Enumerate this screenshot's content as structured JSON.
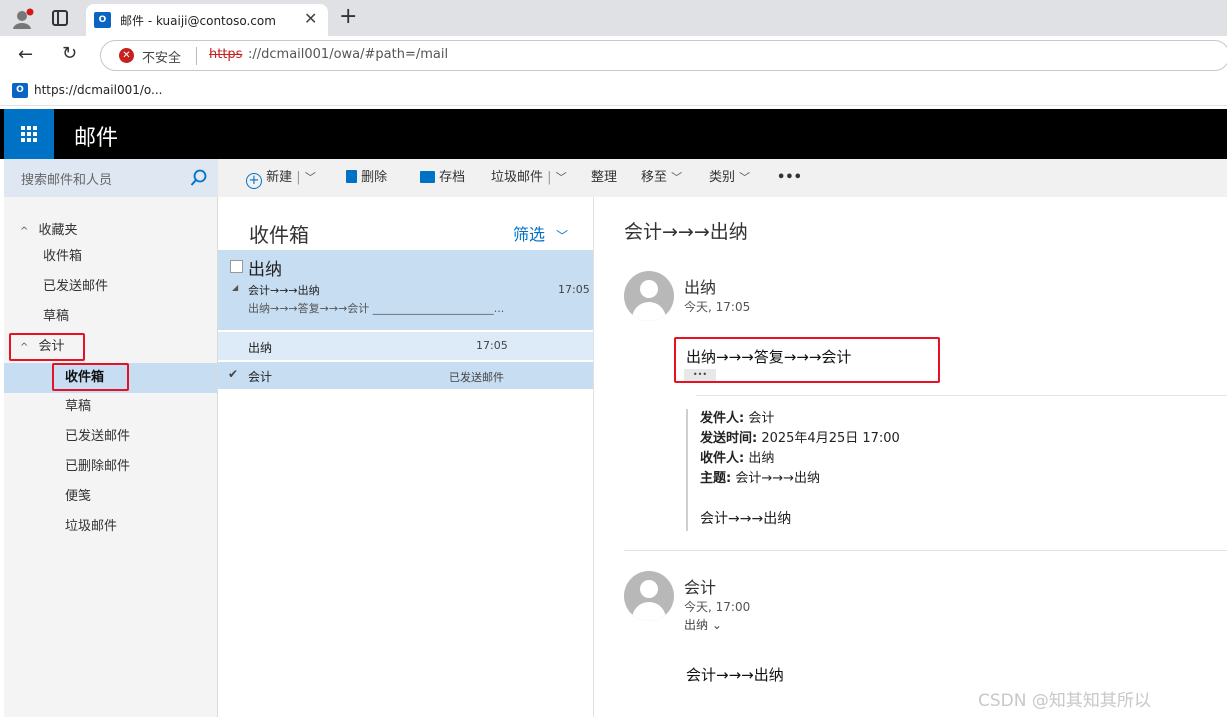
{
  "browser": {
    "tab_title": "邮件 - kuaiji@contoso.com",
    "security_label": "不安全",
    "url_scheme": "https",
    "url_rest": "://dcmail001/owa/#path=/mail",
    "bookmark_label": "https://dcmail001/o..."
  },
  "app": {
    "title": "邮件",
    "search_placeholder": "搜索邮件和人员"
  },
  "toolbar": {
    "new_label": "新建",
    "delete_label": "删除",
    "archive_label": "存档",
    "junk_label": "垃圾邮件",
    "sweep_label": "整理",
    "move_label": "移至",
    "category_label": "类别",
    "more_label": "•••"
  },
  "nav": {
    "favorites_label": "收藏夹",
    "favorites": [
      "收件箱",
      "已发送邮件",
      "草稿"
    ],
    "account_label": "会计",
    "folders": [
      "收件箱",
      "草稿",
      "已发送邮件",
      "已删除邮件",
      "便笺",
      "垃圾邮件"
    ]
  },
  "list": {
    "header": "收件箱",
    "filter_label": "筛选",
    "conversation": {
      "sender": "出纳",
      "subject": "会计→→→出纳",
      "time": "17:05",
      "preview": "出纳→→→答复→→→会计 ______________________..."
    },
    "sub_items": [
      {
        "sender": "出纳",
        "info": "17:05"
      },
      {
        "sender": "会计",
        "info": "已发送邮件"
      }
    ]
  },
  "reading": {
    "subject": "会计→→→出纳",
    "messages": [
      {
        "sender": "出纳",
        "time": "今天, 17:05",
        "body": "出纳→→→答复→→→会计",
        "more": "•••",
        "quote": {
          "from_label": "发件人:",
          "from_value": " 会计",
          "sent_label": "发送时间:",
          "sent_value": " 2025年4月25日 17:00",
          "to_label": "收件人:",
          "to_value": " 出纳",
          "subject_label": "主题:",
          "subject_value": " 会计→→→出纳",
          "body": "会计→→→出纳"
        }
      },
      {
        "sender": "会计",
        "time": "今天, 17:00",
        "to": "出纳 ⌄",
        "body": "会计→→→出纳"
      }
    ]
  },
  "watermark": "CSDN @知其知其所以",
  "colors": {
    "accent": "#0072c6",
    "highlight": "#c7ddf2",
    "annotation": "#e81123"
  }
}
